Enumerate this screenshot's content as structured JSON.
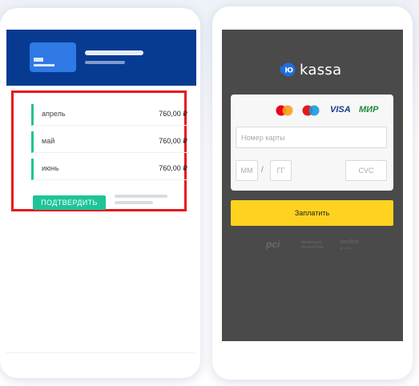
{
  "left_phone": {
    "months": [
      {
        "name": "апрель",
        "amount": "760,00 ₽"
      },
      {
        "name": "май",
        "amount": "760,00 ₽"
      },
      {
        "name": "июнь",
        "amount": "760,00 ₽"
      }
    ],
    "confirm_label": "ПОДТВЕРДИТЬ"
  },
  "right_phone": {
    "logo_text": "kassa",
    "card_brands": [
      "mastercard-icon",
      "maestro-icon",
      "VISA",
      "МИР"
    ],
    "card_number_placeholder": "Номер карты",
    "month_placeholder": "ММ",
    "year_placeholder": "ГГ",
    "date_separator": "/",
    "cvc_placeholder": "CVC",
    "pay_label": "Заплатить",
    "security": {
      "pci": "pci",
      "mastercard_line1": "Mastercard",
      "mastercard_line2": "SecureCode",
      "visa_line1": "Verified",
      "visa_line2": "by VISA"
    }
  },
  "colors": {
    "header_blue": "#073b92",
    "accent_green": "#1ec497",
    "highlight_red": "#e5171b",
    "pay_yellow": "#ffd21f",
    "dark_bg": "#4a4a4a"
  }
}
